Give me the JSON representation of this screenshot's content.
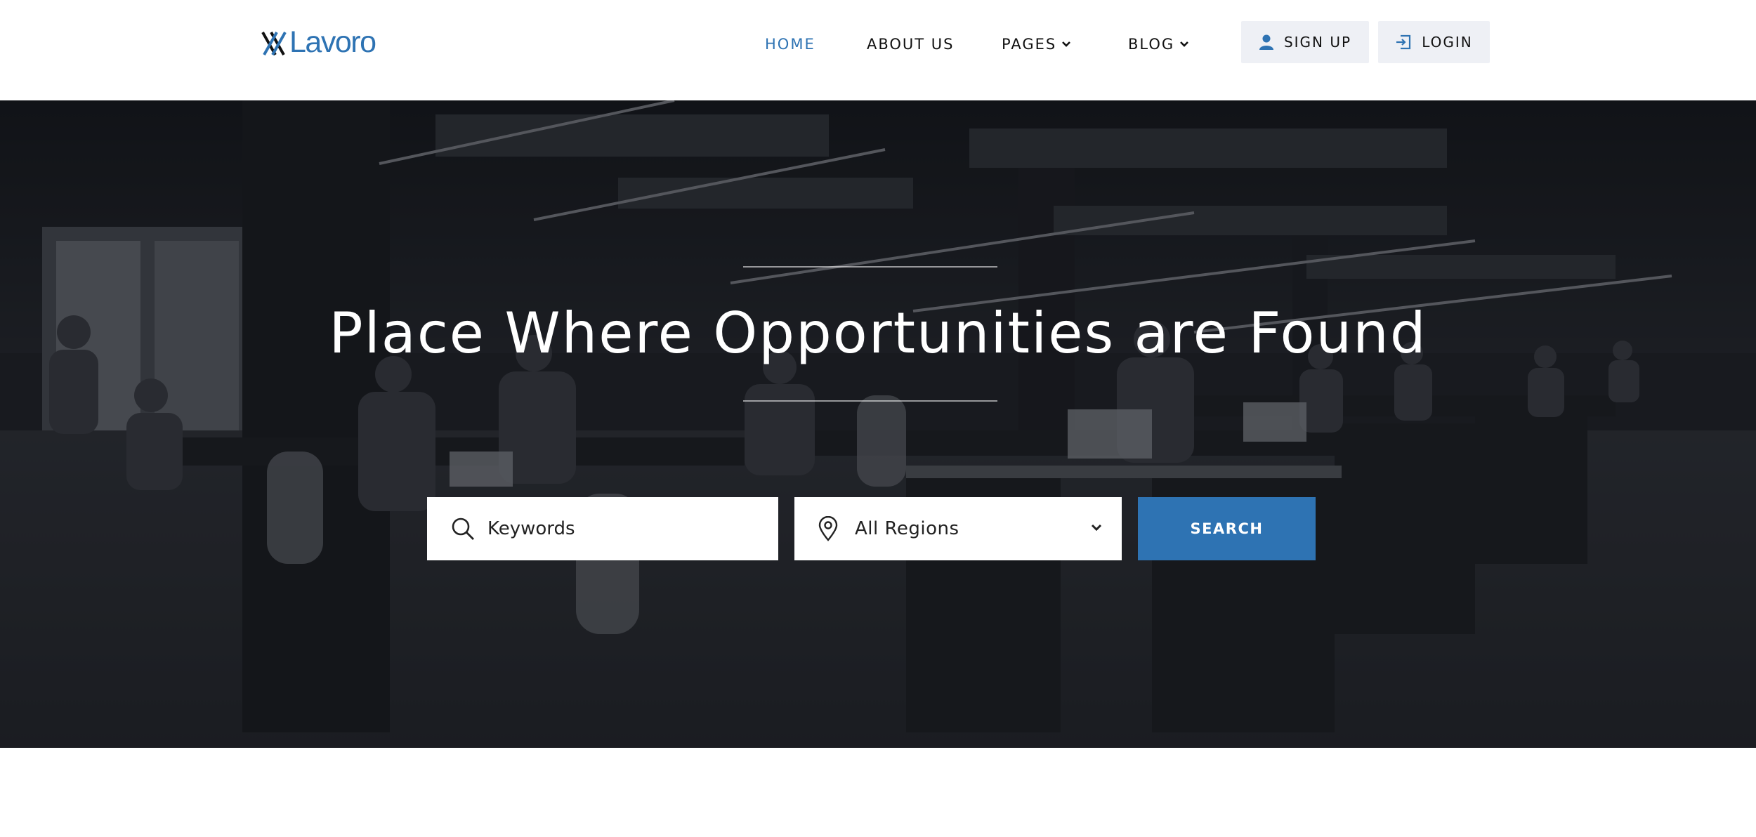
{
  "brand": {
    "name": "Lavoro",
    "color": "#2e73b3"
  },
  "nav": {
    "items": [
      {
        "label": "HOME",
        "active": true,
        "has_dropdown": false
      },
      {
        "label": "ABOUT US",
        "active": false,
        "has_dropdown": false
      },
      {
        "label": "PAGES",
        "active": false,
        "has_dropdown": true
      },
      {
        "label": "BLOG",
        "active": false,
        "has_dropdown": true
      }
    ],
    "signup_label": "SIGN UP",
    "login_label": "LOGIN",
    "active_color": "#2e73b3"
  },
  "hero": {
    "title": "Place Where Opportunities are Found",
    "background": "dark photo of open-plan office with people working at laptops"
  },
  "search": {
    "keywords_placeholder": "Keywords",
    "keywords_value": "",
    "region_selected": "All Regions",
    "button_label": "SEARCH",
    "icons": {
      "keywords": "search-icon",
      "region": "location-pin-icon",
      "dropdown": "chevron-down-icon"
    }
  },
  "colors": {
    "accent": "#2e73b3",
    "auth_button_bg": "#eef0f5"
  }
}
